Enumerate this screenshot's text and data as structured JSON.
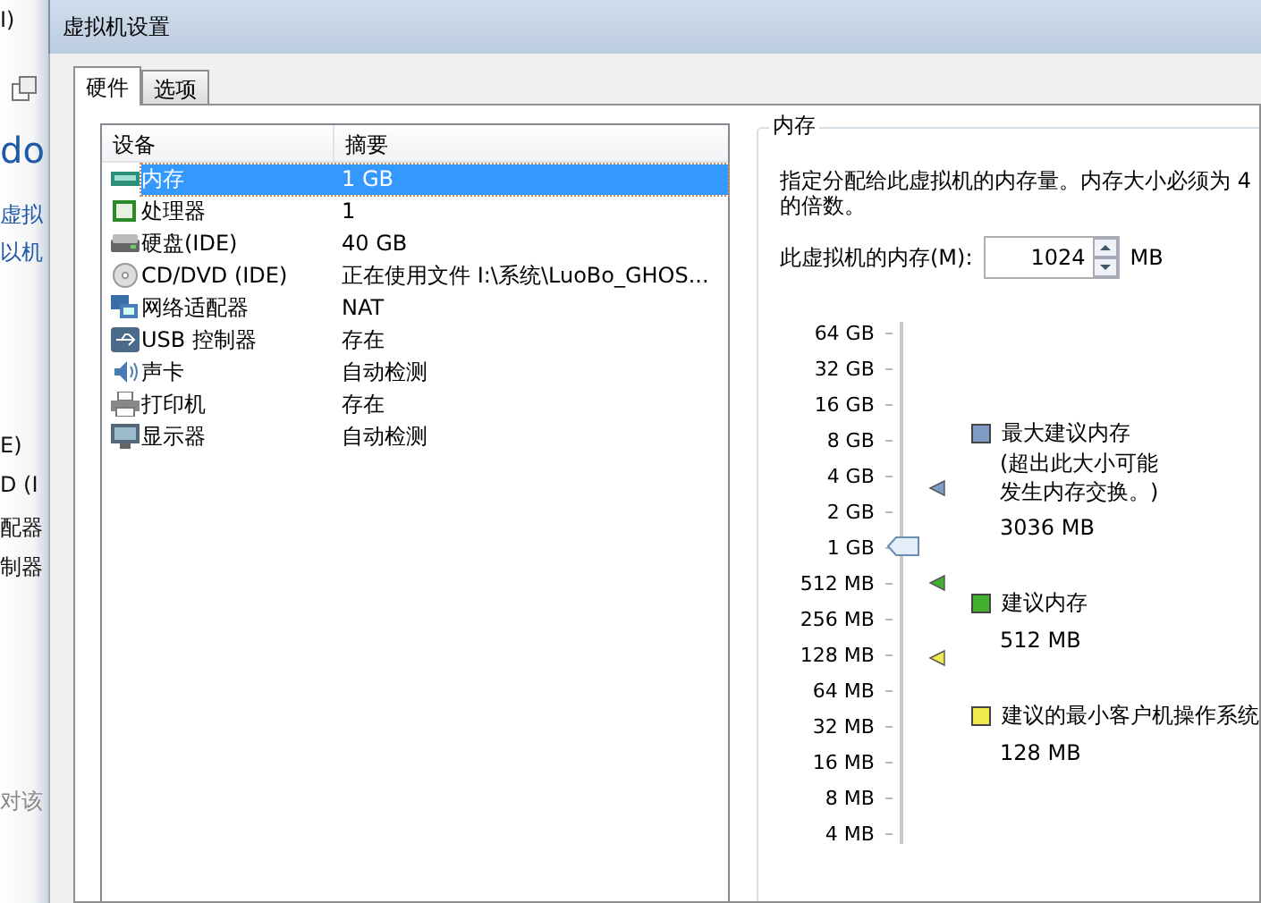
{
  "background_window": {
    "fragments": [
      {
        "text": "I)"
      },
      {
        "text": "do"
      },
      {
        "text": "虚拟"
      },
      {
        "text": "以机"
      },
      {
        "text": "E)"
      },
      {
        "text": "D (I"
      },
      {
        "text": "配器"
      },
      {
        "text": "制器"
      },
      {
        "text": "对该"
      }
    ]
  },
  "window": {
    "title": "虚拟机设置"
  },
  "tabs": [
    {
      "label": "硬件",
      "selected": true
    },
    {
      "label": "选项",
      "selected": false
    }
  ],
  "device_table": {
    "columns": [
      "设备",
      "摘要"
    ],
    "rows": [
      {
        "kind": "memory",
        "device": "内存",
        "summary": "1 GB",
        "selected": true
      },
      {
        "kind": "cpu",
        "device": "处理器",
        "summary": "1",
        "selected": false
      },
      {
        "kind": "disk",
        "device": "硬盘(IDE)",
        "summary": "40 GB",
        "selected": false
      },
      {
        "kind": "cd",
        "device": "CD/DVD (IDE)",
        "summary": "正在使用文件 I:\\系统\\LuoBo_GHOS...",
        "selected": false
      },
      {
        "kind": "network",
        "device": "网络适配器",
        "summary": "NAT",
        "selected": false
      },
      {
        "kind": "usb",
        "device": "USB 控制器",
        "summary": "存在",
        "selected": false
      },
      {
        "kind": "sound",
        "device": "声卡",
        "summary": "自动检测",
        "selected": false
      },
      {
        "kind": "printer",
        "device": "打印机",
        "summary": "存在",
        "selected": false
      },
      {
        "kind": "display",
        "device": "显示器",
        "summary": "自动检测",
        "selected": false
      }
    ]
  },
  "memory_group": {
    "title": "内存",
    "description_lines": [
      "指定分配给此虚拟机的内存量。内存大小必须为 4",
      "的倍数。"
    ],
    "memory_label": "此虚拟机的内存(M):",
    "memory_value": "1024",
    "unit": "MB",
    "scale_labels": [
      "64 GB",
      "32 GB",
      "16 GB",
      "8 GB",
      "4 GB",
      "2 GB",
      "1 GB",
      "512 MB",
      "256 MB",
      "128 MB",
      "64 MB",
      "32 MB",
      "16 MB",
      "8 MB",
      "4 MB"
    ],
    "slider": {
      "level": 0.571
    },
    "legend": [
      {
        "label": "最大建议内存",
        "note_lines": [
          "(超出此大小可能",
          "发生内存交换。)"
        ],
        "value": "3036 MB",
        "color": "#7f9cc4",
        "level": 0.683
      },
      {
        "label": "建议内存",
        "value": "512 MB",
        "color": "#44b030",
        "level": 0.5
      },
      {
        "label": "建议的最小客户机操作系统",
        "value": "128 MB",
        "color": "#f0ea50",
        "level": 0.357
      }
    ]
  }
}
